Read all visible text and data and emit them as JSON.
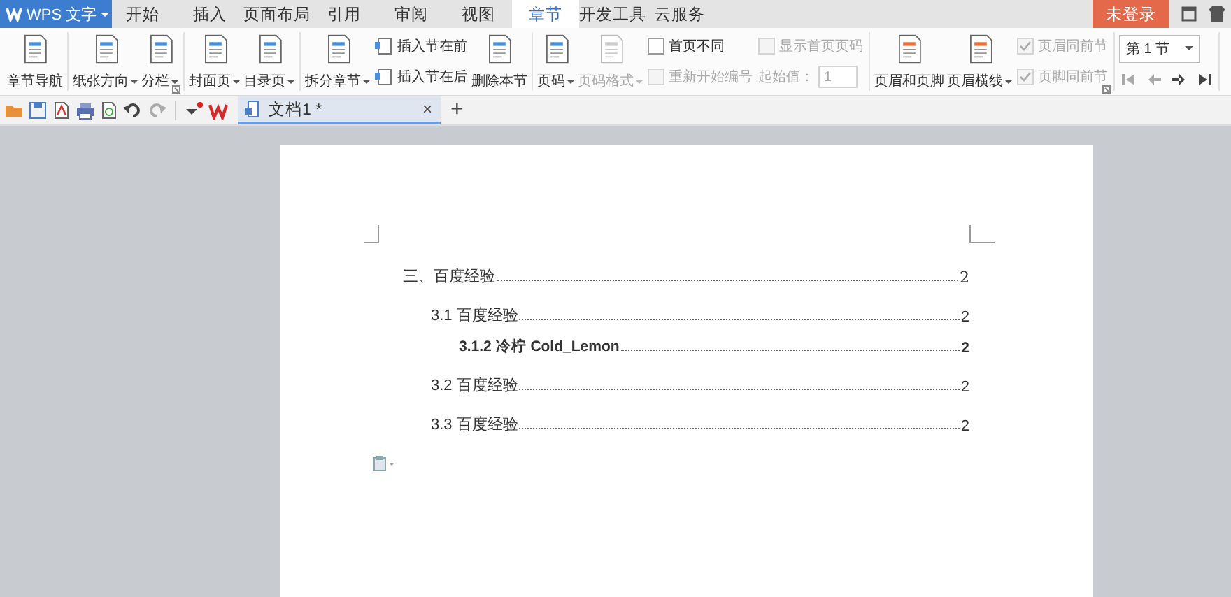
{
  "app_menu": {
    "label": "WPS 文字"
  },
  "tabs": [
    {
      "label": "开始",
      "selected": false
    },
    {
      "label": "插入",
      "selected": false
    },
    {
      "label": "页面布局",
      "selected": false
    },
    {
      "label": "引用",
      "selected": false
    },
    {
      "label": "审阅",
      "selected": false
    },
    {
      "label": "视图",
      "selected": false
    },
    {
      "label": "章节",
      "selected": true
    },
    {
      "label": "开发工具",
      "selected": false
    },
    {
      "label": "云服务",
      "selected": false
    }
  ],
  "account": {
    "label": "未登录"
  },
  "ribbon": {
    "groups": [
      {
        "launcher": false,
        "items": [
          {
            "kind": "big",
            "label": "章节导航",
            "dropdown": false,
            "disabled": false
          }
        ]
      },
      {
        "launcher": true,
        "items": [
          {
            "kind": "big",
            "label": "纸张方向",
            "dropdown": true,
            "disabled": false
          },
          {
            "kind": "big",
            "label": "分栏",
            "dropdown": true,
            "disabled": false
          }
        ]
      },
      {
        "launcher": false,
        "items": [
          {
            "kind": "big",
            "label": "封面页",
            "dropdown": true,
            "disabled": false
          },
          {
            "kind": "big",
            "label": "目录页",
            "dropdown": true,
            "disabled": false
          }
        ]
      },
      {
        "launcher": false,
        "items": [
          {
            "kind": "big",
            "label": "拆分章节",
            "dropdown": true,
            "disabled": false
          },
          {
            "kind": "stack",
            "rows": [
              {
                "kind": "small",
                "label": "插入节在前",
                "disabled": false
              },
              {
                "kind": "small",
                "label": "插入节在后",
                "disabled": false
              }
            ]
          },
          {
            "kind": "big",
            "label": "删除本节",
            "dropdown": false,
            "disabled": false
          }
        ]
      },
      {
        "launcher": false,
        "items": [
          {
            "kind": "big",
            "label": "页码",
            "dropdown": true,
            "disabled": false
          },
          {
            "kind": "big",
            "label": "页码格式",
            "dropdown": true,
            "disabled": true
          },
          {
            "kind": "stack",
            "rows": [
              {
                "kind": "check",
                "label": "首页不同",
                "checked": false,
                "disabled": false
              },
              {
                "kind": "check",
                "label": "重新开始编号",
                "checked": false,
                "disabled": true
              }
            ]
          },
          {
            "kind": "stack",
            "rows": [
              {
                "kind": "check",
                "label": "显示首页页码",
                "checked": false,
                "disabled": true
              },
              {
                "kind": "spin",
                "label": "起始值：",
                "value": "1",
                "disabled": true
              }
            ]
          }
        ]
      },
      {
        "launcher": true,
        "items": [
          {
            "kind": "big",
            "label": "页眉和页脚",
            "dropdown": false,
            "disabled": false
          },
          {
            "kind": "big",
            "label": "页眉横线",
            "dropdown": true,
            "disabled": false
          },
          {
            "kind": "stack",
            "rows": [
              {
                "kind": "check",
                "label": "页眉同前节",
                "checked": true,
                "disabled": true
              },
              {
                "kind": "check",
                "label": "页脚同前节",
                "checked": true,
                "disabled": true
              }
            ]
          }
        ]
      },
      {
        "launcher": false,
        "items": [
          {
            "kind": "stack",
            "rows": [
              {
                "kind": "select",
                "value": "第 1 节"
              },
              {
                "kind": "nav",
                "buttons": [
                  {
                    "disabled": true
                  },
                  {
                    "disabled": true
                  },
                  {
                    "disabled": false
                  },
                  {
                    "disabled": false
                  }
                ]
              }
            ]
          }
        ]
      }
    ]
  },
  "doc_tabs": [
    {
      "title": "文档1 *",
      "selected": true,
      "close": "×"
    }
  ],
  "new_tab": "+",
  "document": {
    "toc": [
      {
        "title": "三、百度经验",
        "page": "2",
        "children": [
          {
            "title": "3.1 百度经验",
            "page": "2",
            "children": [
              {
                "title": "3.1.2 冷柠 Cold_Lemon",
                "page": "2"
              }
            ]
          },
          {
            "title": "3.2 百度经验",
            "page": "2"
          },
          {
            "title": "3.3 百度经验",
            "page": "2"
          }
        ]
      }
    ]
  }
}
